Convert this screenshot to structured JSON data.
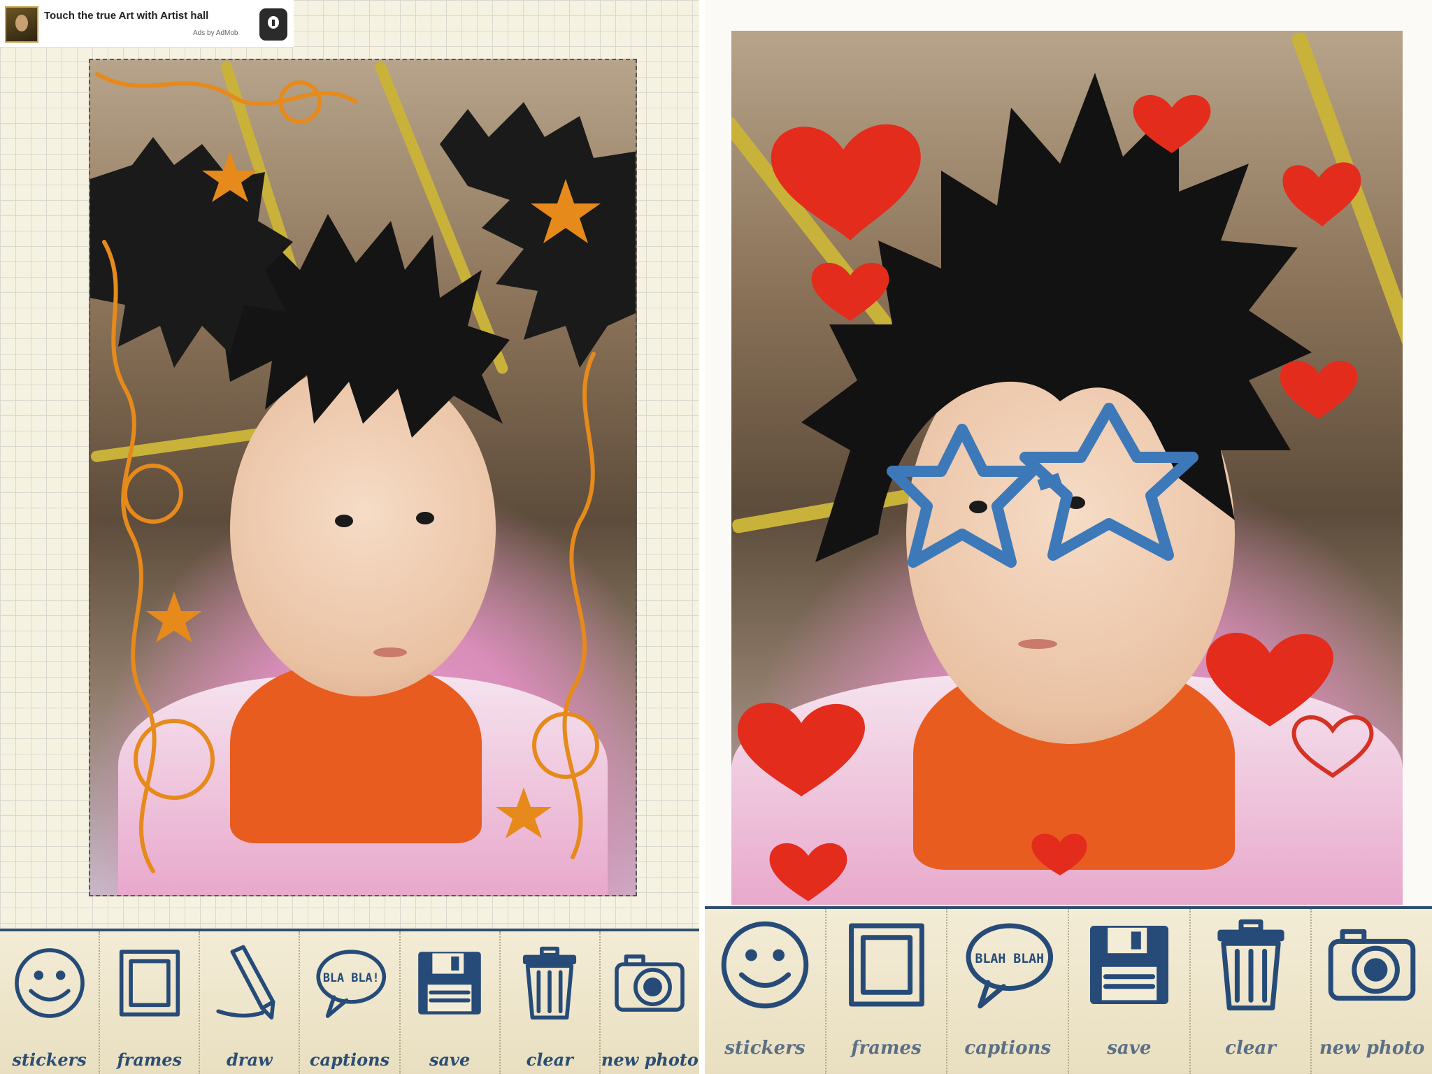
{
  "left_screen": {
    "ad": {
      "title": "Touch the true Art with Artist hall",
      "subtitle": "Ads by AdMob"
    },
    "toolbar": {
      "items": [
        {
          "label": "stickers",
          "icon": "smiley-icon"
        },
        {
          "label": "frames",
          "icon": "frame-icon"
        },
        {
          "label": "draw",
          "icon": "pencil-icon"
        },
        {
          "label": "captions",
          "icon": "speech-bubble-icon",
          "icon_text": "BLA BLA!"
        },
        {
          "label": "save",
          "icon": "floppy-disk-icon"
        },
        {
          "label": "clear",
          "icon": "trash-can-icon"
        },
        {
          "label": "new photo",
          "icon": "camera-icon"
        }
      ]
    }
  },
  "right_screen": {
    "toolbar": {
      "items": [
        {
          "label": "stickers",
          "icon": "smiley-icon"
        },
        {
          "label": "frames",
          "icon": "frame-icon"
        },
        {
          "label": "captions",
          "icon": "speech-bubble-icon",
          "icon_text": "BLAH BLAH"
        },
        {
          "label": "save",
          "icon": "floppy-disk-icon"
        },
        {
          "label": "clear",
          "icon": "trash-can-icon"
        },
        {
          "label": "new photo",
          "icon": "camera-icon"
        }
      ]
    }
  },
  "colors": {
    "ink_blue": "#264b78",
    "toolbar_border": "#2f4f6f",
    "sticker_orange": "#e68a1c",
    "sticker_red": "#e42c1c",
    "glasses_blue": "#3d79b8"
  }
}
